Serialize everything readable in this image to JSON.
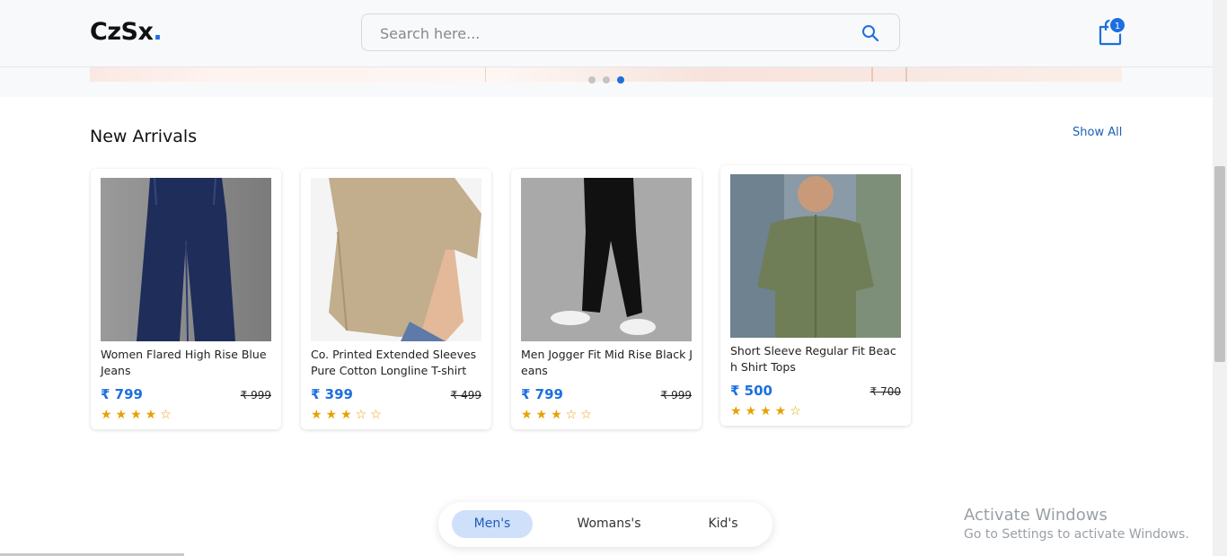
{
  "header": {
    "logo_text": "CzSx",
    "logo_dot": ".",
    "search_placeholder": "Search here...",
    "cart_count": "1"
  },
  "section": {
    "title": "New Arrivals",
    "show_all": "Show All"
  },
  "products": [
    {
      "name": "Women Flared High Rise Blue Jeans",
      "price": "₹ 799",
      "old_price": "₹ 999",
      "stars": "★★★★☆",
      "rating": 4
    },
    {
      "name": "Co. Printed Extended Sleeves Pure Cotton Longline T-shirt",
      "price": "₹ 399",
      "old_price": "₹ 499",
      "stars": "★★★☆☆",
      "rating": 3
    },
    {
      "name": "Men Jogger Fit Mid Rise Black Jeans",
      "price": "₹ 799",
      "old_price": "₹ 999",
      "stars": "★★★☆☆",
      "rating": 3
    },
    {
      "name": "Short Sleeve Regular Fit Beach Shirt Tops",
      "price": "₹ 500",
      "old_price": "₹ 700",
      "stars": "★★★★☆",
      "rating": 4
    }
  ],
  "tabs": [
    {
      "label": "Men's",
      "active": true
    },
    {
      "label": "Womans's",
      "active": false
    },
    {
      "label": "Kid's",
      "active": false
    }
  ],
  "watermark": {
    "line1": "Activate Windows",
    "line2": "Go to Settings to activate Windows."
  },
  "colors": {
    "accent": "#1d6fe0",
    "star": "#e6a100"
  }
}
